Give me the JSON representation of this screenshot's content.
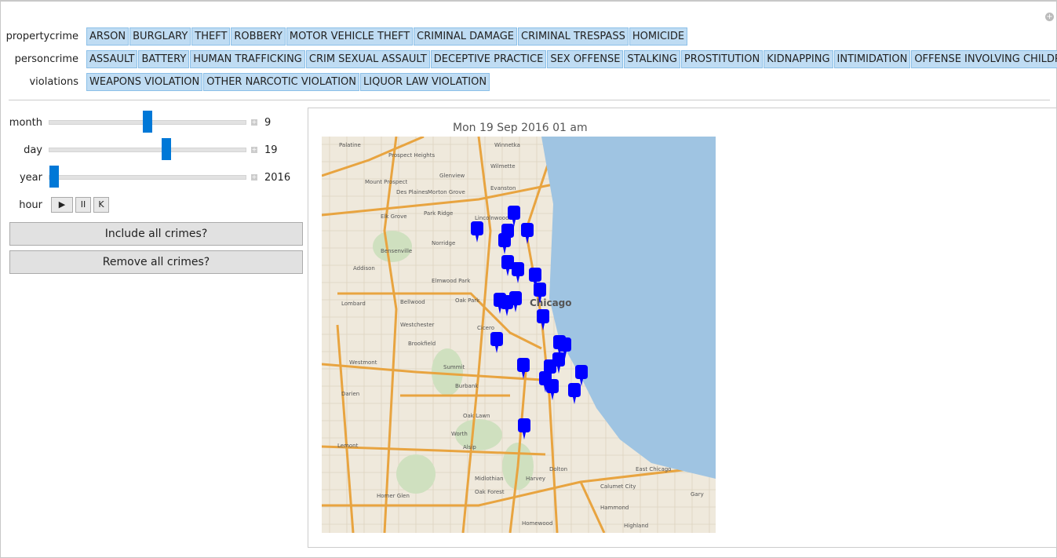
{
  "rows": [
    {
      "label": "propertycrime",
      "items": [
        "ARSON",
        "BURGLARY",
        "THEFT",
        "ROBBERY",
        "MOTOR VEHICLE THEFT",
        "CRIMINAL DAMAGE",
        "CRIMINAL TRESPASS",
        "HOMICIDE"
      ]
    },
    {
      "label": "personcrime",
      "items": [
        "ASSAULT",
        "BATTERY",
        "HUMAN TRAFFICKING",
        "CRIM SEXUAL ASSAULT",
        "DECEPTIVE PRACTICE",
        "SEX OFFENSE",
        "STALKING",
        "PROSTITUTION",
        "KIDNAPPING",
        "INTIMIDATION",
        "OFFENSE INVOLVING CHILDREN"
      ]
    },
    {
      "label": "violations",
      "items": [
        "WEAPONS VIOLATION",
        "OTHER NARCOTIC  VIOLATION",
        "LIQUOR LAW VIOLATION"
      ]
    }
  ],
  "controls": {
    "month": {
      "label": "month",
      "value": "9",
      "fraction": 0.5
    },
    "day": {
      "label": "day",
      "value": "19",
      "fraction": 0.6
    },
    "year": {
      "label": "year",
      "value": "2016",
      "fraction": 0.0
    },
    "hour": {
      "label": "hour",
      "buttons": [
        "▶",
        "II",
        "K"
      ]
    }
  },
  "buttons": {
    "include": "Include all crimes?",
    "remove": "Remove all crimes?"
  },
  "map": {
    "title": "Mon 19 Sep 2016 01 am",
    "marker_color": "#0000ff",
    "lake_color": "#9fc4e2",
    "land_color": "#efe9dc",
    "road_color": "#e8a440",
    "labels": [
      "Palatine",
      "Prospect Heights",
      "Winnetka",
      "Wilmette",
      "Mount Prospect",
      "Glenview",
      "Des Plaines",
      "Morton Grove",
      "Evanston",
      "Elk Grove",
      "Park Ridge",
      "Lincolnwood",
      "Norridge",
      "Bensenville",
      "Addison",
      "Elmwood Park",
      "Lombard",
      "Bellwood",
      "Oak Park",
      "Chicago",
      "Westchester",
      "Cicero",
      "Brookfield",
      "Summit",
      "Westmont",
      "Burbank",
      "Darien",
      "Oak Lawn",
      "Worth",
      "Alsip",
      "Lemont",
      "Midlothian",
      "Harvey",
      "Dolton",
      "Calumet City",
      "East Chicago",
      "Hammond",
      "Oak Forest",
      "Homer Glen",
      "Homewood",
      "Highland",
      "Gary"
    ],
    "marker_count": 24
  }
}
